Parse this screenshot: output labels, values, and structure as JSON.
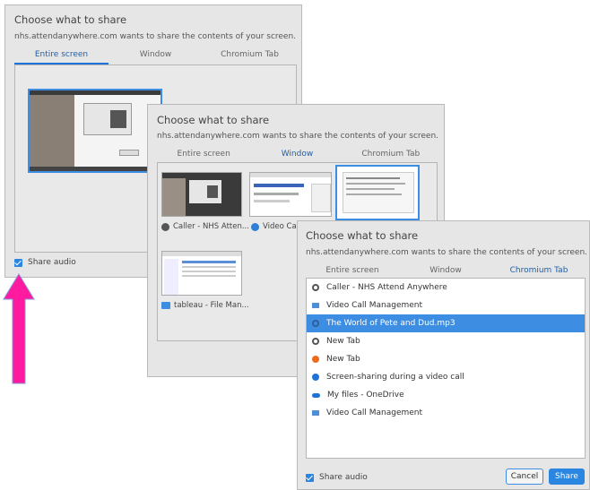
{
  "dialog1": {
    "title": "Choose what to share",
    "subtitle": "nhs.attendanywhere.com wants to share the contents of your screen.",
    "tabs": [
      {
        "label": "Entire screen",
        "active": true
      },
      {
        "label": "Window",
        "active": false
      },
      {
        "label": "Chromium Tab",
        "active": false
      }
    ],
    "share_audio_label": "Share audio"
  },
  "dialog2": {
    "title": "Choose what to share",
    "subtitle": "nhs.attendanywhere.com wants to share the contents of your screen.",
    "tabs": [
      {
        "label": "Entire screen",
        "active": false
      },
      {
        "label": "Window",
        "active": true
      },
      {
        "label": "Chromium Tab",
        "active": false
      }
    ],
    "windows": [
      {
        "label": "Caller - NHS Atten...",
        "icon": "chromium-icon"
      },
      {
        "label": "Video Call M",
        "icon": "chrome-icon"
      },
      {
        "label": "tableau - File Man...",
        "icon": "folder-icon"
      }
    ]
  },
  "dialog3": {
    "title": "Choose what to share",
    "subtitle": "nhs.attendanywhere.com wants to share the contents of your screen.",
    "tabs": [
      {
        "label": "Entire screen",
        "active": false
      },
      {
        "label": "Window",
        "active": false
      },
      {
        "label": "Chromium Tab",
        "active": true
      }
    ],
    "tab_items": [
      {
        "label": "Caller - NHS Attend Anywhere",
        "icon": "chromium-icon",
        "selected": false
      },
      {
        "label": "Video Call Management",
        "icon": "page-icon",
        "selected": false
      },
      {
        "label": "The World of Pete and Dud.mp3",
        "icon": "chromium-icon",
        "selected": true
      },
      {
        "label": "New Tab",
        "icon": "chromium-icon",
        "selected": false
      },
      {
        "label": "New Tab",
        "icon": "brave-icon",
        "selected": false
      },
      {
        "label": "Screen-sharing during a video call",
        "icon": "globe-icon",
        "selected": false
      },
      {
        "label": "My files - OneDrive",
        "icon": "cloud-icon",
        "selected": false
      },
      {
        "label": "Video Call Management",
        "icon": "page-icon",
        "selected": false
      }
    ],
    "share_audio_label": "Share audio",
    "cancel_label": "Cancel",
    "share_label": "Share"
  },
  "colors": {
    "accent": "#2a86e0",
    "selected_row": "#3d8ee2",
    "arrow": "#ff1aa0"
  }
}
